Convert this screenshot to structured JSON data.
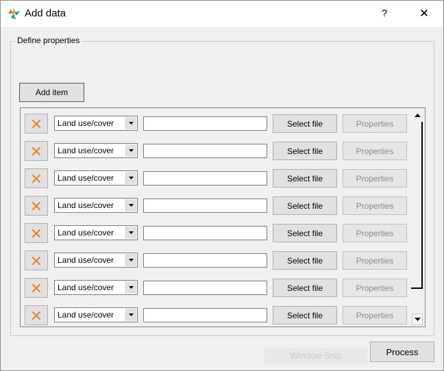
{
  "window": {
    "title": "Add data",
    "help_label": "?",
    "close_glyph": "✕",
    "icon": "app-logo-icon"
  },
  "group": {
    "label": "Define properties"
  },
  "toolbar": {
    "add_item_label": "Add item"
  },
  "rows": [
    {
      "type": "Land use/cover",
      "file_value": "",
      "select_label": "Select file",
      "properties_label": "Properties"
    },
    {
      "type": "Land use/cover",
      "file_value": "",
      "select_label": "Select file",
      "properties_label": "Properties"
    },
    {
      "type": "Land use/cover",
      "file_value": "",
      "select_label": "Select file",
      "properties_label": "Properties"
    },
    {
      "type": "Land use/cover",
      "file_value": "",
      "select_label": "Select file",
      "properties_label": "Properties"
    },
    {
      "type": "Land use/cover",
      "file_value": "",
      "select_label": "Select file",
      "properties_label": "Properties"
    },
    {
      "type": "Land use/cover",
      "file_value": "",
      "select_label": "Select file",
      "properties_label": "Properties"
    },
    {
      "type": "Land use/cover",
      "file_value": "",
      "select_label": "Select file",
      "properties_label": "Properties"
    },
    {
      "type": "Land use/cover",
      "file_value": "",
      "select_label": "Select file",
      "properties_label": "Properties"
    }
  ],
  "footer": {
    "process_label": "Process",
    "overlay_text": "Window Snip"
  },
  "colors": {
    "delete_icon": "#f07d1e",
    "window_bg": "#f0f0f0",
    "disabled_text": "#8a8a8a"
  }
}
